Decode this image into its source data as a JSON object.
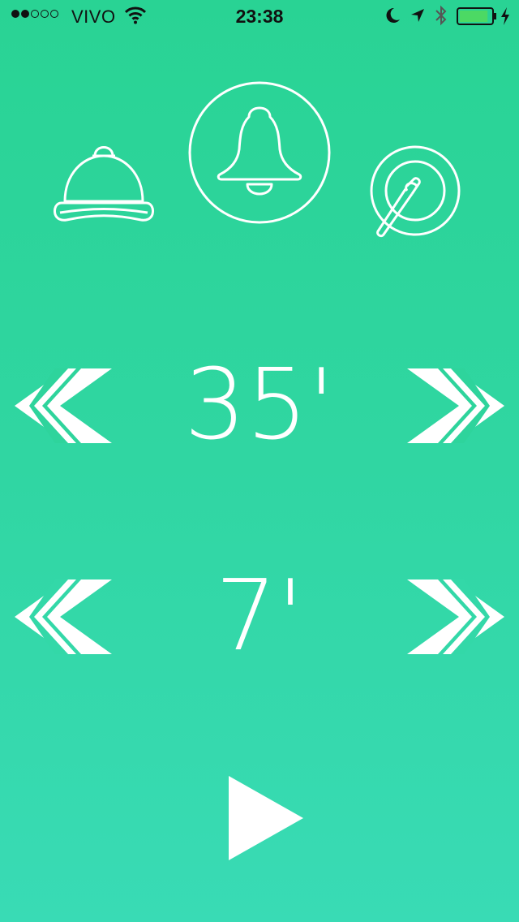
{
  "status_bar": {
    "carrier": "VIVO",
    "time": "23:38",
    "signal_bars_filled": 2,
    "signal_bars_total": 5,
    "battery_level": 0.9,
    "battery_color": "#4CD964",
    "icons": [
      "wifi-icon",
      "moon-icon",
      "location-icon",
      "bluetooth-icon",
      "battery-icon",
      "charging-icon"
    ]
  },
  "sounds": {
    "options": [
      "desk-bell",
      "bell",
      "gong"
    ],
    "selected": "bell"
  },
  "timer": {
    "work_value": "35'",
    "break_value": "7'"
  },
  "controls": {
    "decrease_icon": "double-chevron-left-icon",
    "increase_icon": "double-chevron-right-icon",
    "play_icon": "play-icon"
  },
  "colors": {
    "background_top": "#29D394",
    "background_bottom": "#39DBB5",
    "foreground": "#FFFFFF"
  }
}
